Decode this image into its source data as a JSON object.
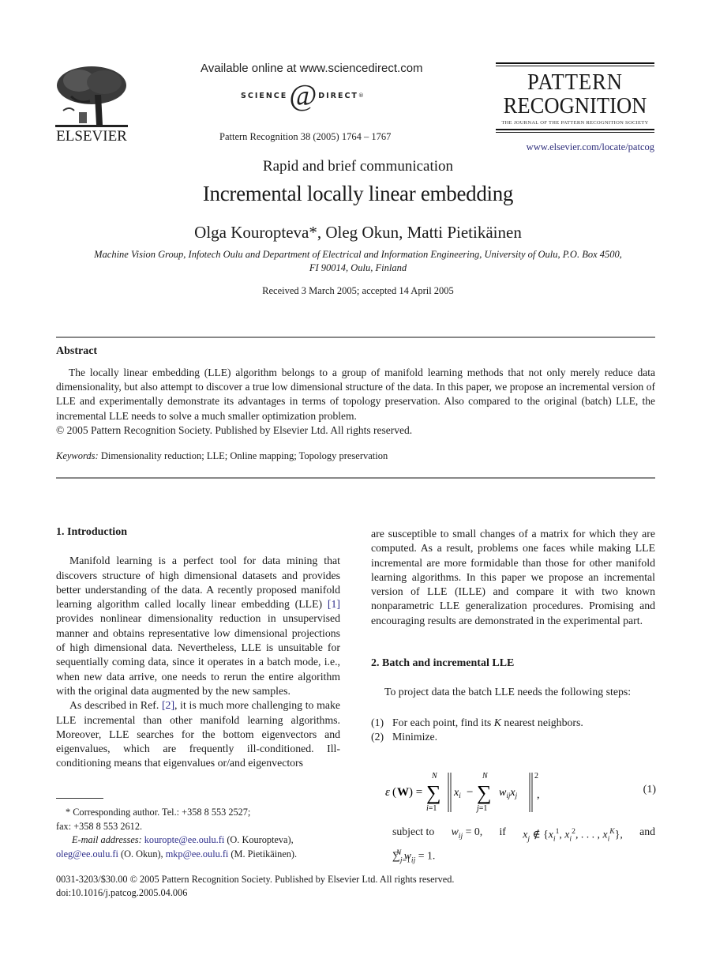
{
  "header": {
    "publisher": "ELSEVIER",
    "available_online": "Available online at www.sciencedirect.com",
    "sciencedirect_left": "SCIENCE",
    "sciencedirect_at": "d",
    "sciencedirect_right": "DIRECT",
    "sciencedirect_mark": "®",
    "citation": "Pattern Recognition 38 (2005) 1764 – 1767",
    "journal_title_line1": "PATTERN",
    "journal_title_line2": "RECOGNITION",
    "journal_subtitle": "THE JOURNAL OF THE PATTERN RECOGNITION SOCIETY",
    "journal_url": "www.elsevier.com/locate/patcog"
  },
  "article": {
    "type": "Rapid and brief communication",
    "title": "Incremental locally linear embedding",
    "authors": "Olga Kouropteva*, Oleg Okun, Matti Pietikäinen",
    "affiliation_line1": "Machine Vision Group, Infotech Oulu and Department of Electrical and Information Engineering, University of Oulu, P.O. Box 4500,",
    "affiliation_line2": "FI 90014, Oulu, Finland",
    "received": "Received 3 March 2005; accepted 14 April 2005"
  },
  "abstract": {
    "heading": "Abstract",
    "body": "The locally linear embedding (LLE) algorithm belongs to a group of manifold learning methods that not only merely reduce data dimensionality, but also attempt to discover a true low dimensional structure of the data. In this paper, we propose an incremental version of LLE and experimentally demonstrate its advantages in terms of topology preservation. Also compared to the original (batch) LLE, the incremental LLE needs to solve a much smaller optimization problem.",
    "copyright": "© 2005 Pattern Recognition Society. Published by Elsevier Ltd. All rights reserved.",
    "keywords_label": "Keywords:",
    "keywords": "Dimensionality reduction; LLE; Online mapping; Topology preservation"
  },
  "sections": {
    "intro_heading": "1.  Introduction",
    "intro_p1_a": "Manifold learning is a perfect tool for data mining that discovers structure of high dimensional datasets and provides better understanding of the data. A recently proposed manifold learning algorithm called locally linear embedding (LLE) ",
    "intro_p1_ref": "[1]",
    "intro_p1_b": " provides nonlinear dimensionality reduction in unsupervised manner and obtains representative low dimensional projections of high dimensional data. Nevertheless, LLE is unsuitable for sequentially coming data, since it operates in a batch mode, i.e., when new data arrive, one needs to rerun the entire algorithm with the original data augmented by the new samples.",
    "intro_p2_a": "As described in Ref. ",
    "intro_p2_ref": "[2]",
    "intro_p2_b": ", it is much more challenging to make LLE incremental than other manifold learning algorithms. Moreover, LLE searches for the bottom eigenvectors and eigenvalues, which are frequently ill-conditioned. Ill-conditioning means that eigenvalues or/and eigenvectors",
    "right_p1": "are susceptible to small changes of a matrix for which they are computed. As a result, problems one faces while making LLE incremental are more formidable than those for other manifold learning algorithms. In this paper we propose an incremental version of LLE (ILLE) and compare it with two known nonparametric LLE generalization procedures. Promising and encouraging results are demonstrated in the experimental part.",
    "batch_heading": "2.  Batch and incremental LLE",
    "batch_intro": "To project data the batch LLE needs the following steps:",
    "steps": [
      {
        "num": "(1)",
        "text_a": "For each point, find its ",
        "var": "K",
        "text_b": " nearest neighbors."
      },
      {
        "num": "(2)",
        "text_a": "Minimize.",
        "var": "",
        "text_b": ""
      }
    ],
    "equation_number": "(1)",
    "constraint_a": "subject to",
    "constraint_b": "and"
  },
  "footnotes": {
    "corresponding": "* Corresponding author. Tel.: +358 8 553 2527;",
    "fax": "fax: +358 8 553 2612.",
    "email_label": "E-mail addresses:",
    "email1": "kouropte@ee.oulu.fi",
    "email1_name": " (O. Kouropteva),",
    "email2": "oleg@ee.oulu.fi",
    "email2_name": " (O. Okun), ",
    "email3": "mkp@ee.oulu.fi",
    "email3_name": " (M. Pietikäinen)."
  },
  "footer": {
    "issn": "0031-3203/$30.00 © 2005 Pattern Recognition Society. Published by Elsevier Ltd. All rights reserved.",
    "doi": "doi:10.1016/j.patcog.2005.04.006"
  }
}
